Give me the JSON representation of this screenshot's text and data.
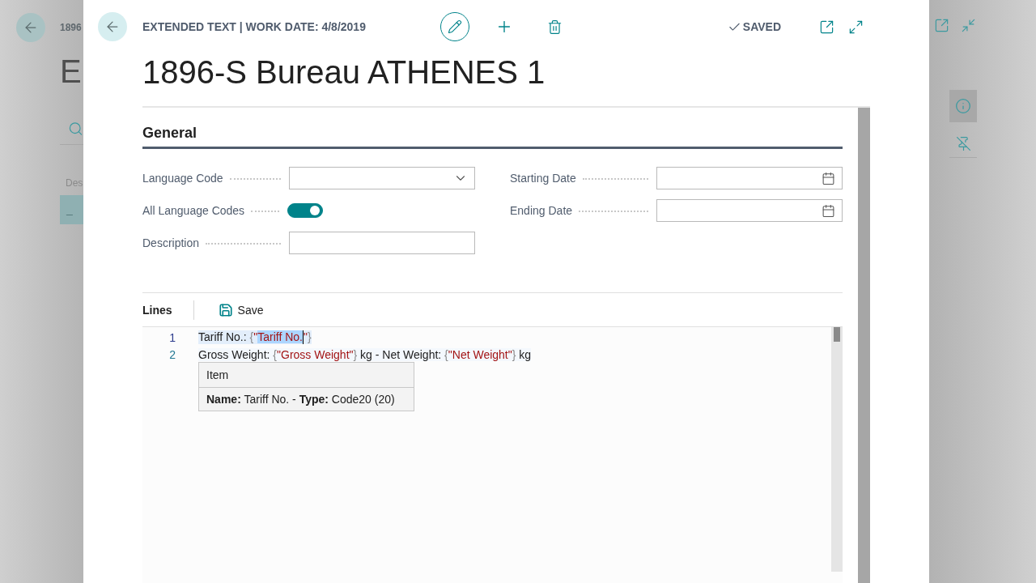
{
  "background": {
    "caption": "1896",
    "title": "E",
    "column_header": "Des",
    "row_marker": "_"
  },
  "dialog": {
    "caption": "EXTENDED TEXT | WORK DATE: 4/8/2019",
    "status": "SAVED",
    "title": "1896-S Bureau ATHENES 1"
  },
  "general": {
    "heading": "General",
    "left_fields": [
      {
        "label": "Language Code",
        "kind": "dropdown"
      },
      {
        "label": "All Language Codes",
        "kind": "toggle",
        "on": true
      },
      {
        "label": "Description",
        "kind": "text"
      }
    ],
    "right_fields": [
      {
        "label": "Starting Date",
        "kind": "date"
      },
      {
        "label": "Ending Date",
        "kind": "date"
      }
    ]
  },
  "lines": {
    "heading": "Lines",
    "save_action": "Save",
    "editor_lines": [
      {
        "number": "1",
        "current": true,
        "segments": [
          {
            "text": "Tariff No.: ",
            "kind": "plain",
            "selected": false
          },
          {
            "text": "{",
            "kind": "brace",
            "selected": false
          },
          {
            "text": "\"",
            "kind": "string",
            "selected": false
          },
          {
            "text": "Tariff No.",
            "kind": "string",
            "selected": true
          },
          {
            "text": "\"",
            "kind": "string",
            "selected": false
          },
          {
            "text": "}",
            "kind": "brace",
            "selected": false
          }
        ]
      },
      {
        "number": "2",
        "current": false,
        "segments": [
          {
            "text": "Gross Weight: ",
            "kind": "plain",
            "selected": false
          },
          {
            "text": "{",
            "kind": "brace",
            "selected": false
          },
          {
            "text": "\"Gross Weight\"",
            "kind": "string",
            "selected": false
          },
          {
            "text": "}",
            "kind": "brace",
            "selected": false
          },
          {
            "text": " kg - Net Weight: ",
            "kind": "plain",
            "selected": false
          },
          {
            "text": "{",
            "kind": "brace",
            "selected": false
          },
          {
            "text": "\"Net Weight\"",
            "kind": "string",
            "selected": false
          },
          {
            "text": "}",
            "kind": "brace",
            "selected": false
          },
          {
            "text": " kg",
            "kind": "plain",
            "selected": false
          }
        ]
      }
    ],
    "hint": {
      "header": "Item",
      "detail": "**Name:** Tariff No. - **Type:** Code20 (20)"
    }
  }
}
